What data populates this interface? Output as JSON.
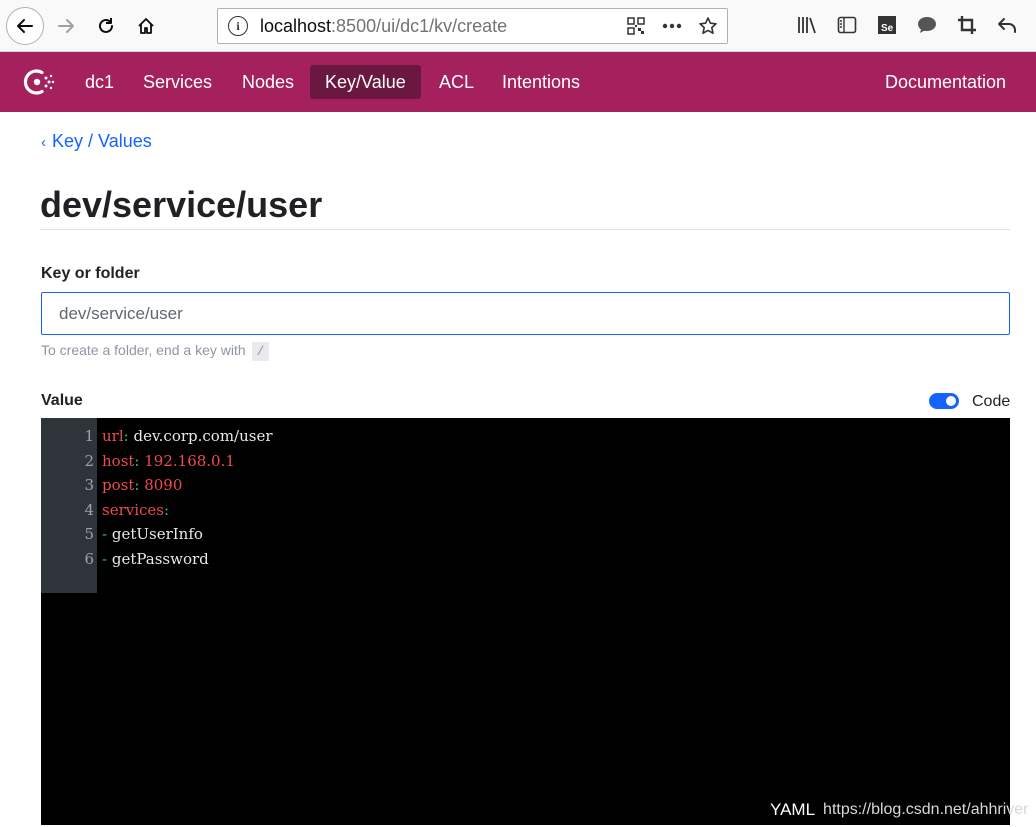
{
  "browser": {
    "url_host": "localhost",
    "url_path": ":8500/ui/dc1/kv/create"
  },
  "nav": {
    "datacenter": "dc1",
    "items": [
      {
        "label": "Services"
      },
      {
        "label": "Nodes"
      },
      {
        "label": "Key/Value",
        "active": true
      },
      {
        "label": "ACL"
      },
      {
        "label": "Intentions"
      }
    ],
    "documentation": "Documentation",
    "brand_color": "#a5215d",
    "active_color": "#6b1840"
  },
  "breadcrumb": {
    "label": "Key / Values"
  },
  "page": {
    "title": "dev/service/user"
  },
  "form": {
    "key_label": "Key or folder",
    "key_value": "dev/service/user",
    "hint_text": "To create a folder, end a key with",
    "hint_code": "/",
    "value_label": "Value",
    "code_toggle_label": "Code",
    "code_toggle_on": true
  },
  "editor": {
    "lines": [
      {
        "num": "1",
        "key": "url",
        "colon": ":",
        "value": " dev.corp.com/user",
        "value_type": "plain"
      },
      {
        "num": "2",
        "key": "host",
        "colon": ":",
        "value": " 192.168.0.1",
        "value_type": "number"
      },
      {
        "num": "3",
        "key": "post",
        "colon": ":",
        "value": " 8090",
        "value_type": "number"
      },
      {
        "num": "4",
        "key": "services",
        "colon": ":",
        "value": "",
        "value_type": "plain"
      },
      {
        "num": "5",
        "key": "",
        "colon": "-",
        "value": " getUserInfo",
        "value_type": "plain"
      },
      {
        "num": "6",
        "key": "",
        "colon": "-",
        "value": " getPassword",
        "value_type": "plain"
      }
    ],
    "mode": "YAML",
    "watermark": "https://blog.csdn.net/ahhriver"
  }
}
